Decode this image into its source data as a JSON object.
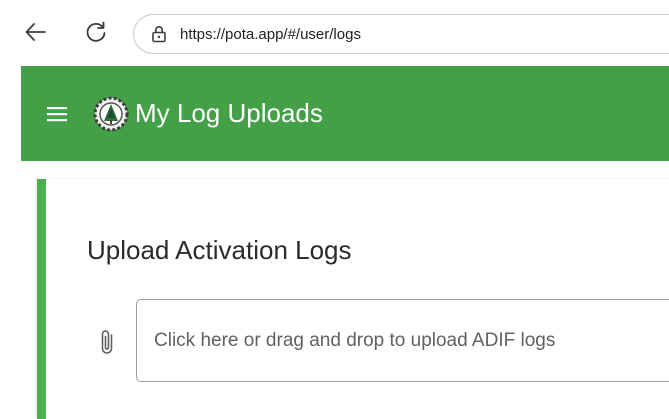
{
  "browser": {
    "url": "https://pota.app/#/user/logs",
    "back_icon": "arrow-left-icon",
    "reload_icon": "reload-icon",
    "site_info_icon": "lock-icon"
  },
  "header": {
    "title": "My Log Uploads",
    "menu_icon": "hamburger-menu-icon",
    "logo": "pota-logo",
    "background_color": "#43a047"
  },
  "card": {
    "title": "Upload Activation Logs",
    "accent_color": "#4caf50",
    "upload": {
      "icon": "paperclip-icon",
      "placeholder": "Click here or drag and drop to upload ADIF logs"
    }
  }
}
